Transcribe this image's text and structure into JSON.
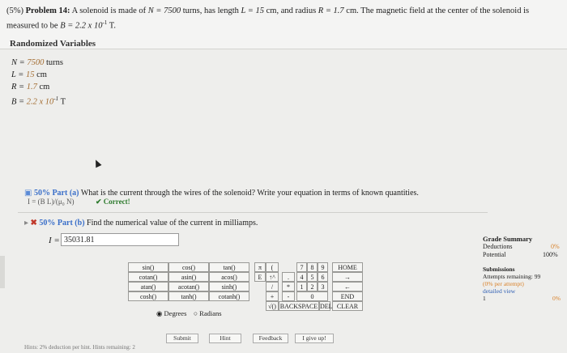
{
  "problem": {
    "prefix": "(5%) ",
    "label": "Problem 14:",
    "text_a": " A solenoid is made of ",
    "N_expr": "N = 7500",
    "text_b": " turns, has length ",
    "L_expr": "L = 15",
    "text_c": " cm, and radius ",
    "R_expr": "R = 1.7",
    "text_d": " cm. The magnetic field at the center of the solenoid is measured to be ",
    "B_expr": "B = 2.2 x 10",
    "B_exp": "-1",
    "text_e": " T."
  },
  "randomized": {
    "title": "Randomized Variables",
    "vars": [
      {
        "name": "N = ",
        "value": "7500",
        "unit": " turns"
      },
      {
        "name": "L = ",
        "value": "15",
        "unit": " cm"
      },
      {
        "name": "R = ",
        "value": "1.7",
        "unit": " cm"
      },
      {
        "name": "B = ",
        "value": "2.2 x 10",
        "exp": "-1",
        "unit": " T"
      }
    ]
  },
  "partA": {
    "percent": "50% Part (a)",
    "question": "What is the current through the wires of the solenoid? Write your equation in terms of known quantities.",
    "answer": "I = (B L)/(μ₀ N)",
    "status": "✔ Correct!"
  },
  "partB": {
    "percent": "50% Part (b)",
    "question": "Find the numerical value of the current in milliamps.",
    "answer_label": "I = ",
    "answer_value": "35031.81"
  },
  "keypad": {
    "functions": [
      [
        "sin()",
        "cos()",
        "tan()"
      ],
      [
        "cotan()",
        "asin()",
        "acos()"
      ],
      [
        "atan()",
        "acotan()",
        "sinh()"
      ],
      [
        "cosh()",
        "tanh()",
        "cotanh()"
      ]
    ],
    "symbols": [
      [
        "π",
        "("
      ],
      [
        "E",
        "↑^"
      ],
      [
        "",
        "/"
      ],
      [
        "",
        "+"
      ],
      [
        "",
        "√()"
      ]
    ],
    "digits": [
      [
        "7",
        "8",
        "9"
      ],
      [
        "4",
        "5",
        "6"
      ],
      [
        "1",
        "2",
        "3"
      ],
      [
        "",
        "0",
        ""
      ]
    ],
    "ops": [
      "HOME",
      "→",
      "←",
      "END",
      "CLEAR"
    ],
    "misc": [
      "*",
      "-",
      ".",
      "BACKSPACE",
      "DEL"
    ],
    "angle": {
      "degrees": "Degrees",
      "radians": "Radians"
    }
  },
  "buttons": {
    "submit": "Submit",
    "hint": "Hint",
    "feedback": "Feedback",
    "give_up": "I give up!"
  },
  "hints_line": "Hints: 2% deduction per hint. Hints remaining: 2",
  "grade": {
    "title": "Grade Summary",
    "deductions_label": "Deductions",
    "deductions_value": "0%",
    "potential_label": "Potential",
    "potential_value": "100%",
    "submissions_title": "Submissions",
    "attempts": "Attempts remaining: 99",
    "per_attempt": "(0% per attempt)",
    "detailed": "detailed view",
    "row_num": "1",
    "row_pct": "0%"
  }
}
